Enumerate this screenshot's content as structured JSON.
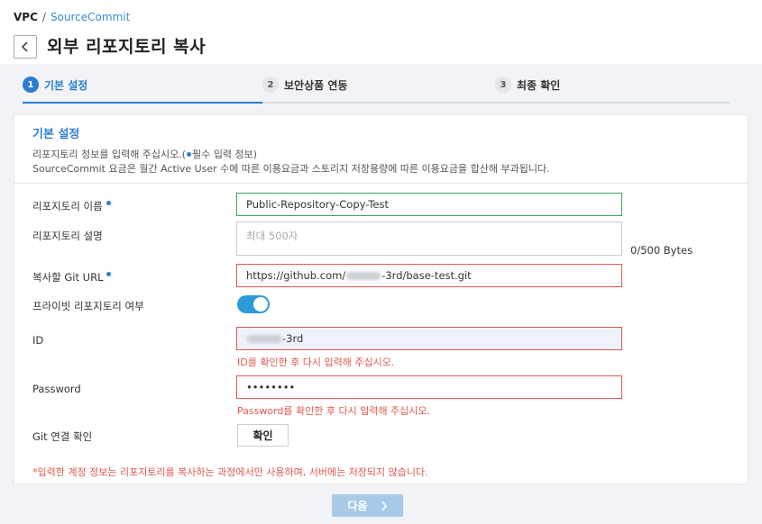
{
  "breadcrumb": {
    "root": "VPC",
    "separator": "/",
    "link": "SourceCommit"
  },
  "page_title": "외부 리포지토리 복사",
  "steps": [
    {
      "num": "1",
      "label": "기본 설정"
    },
    {
      "num": "2",
      "label": "보안상품 연동"
    },
    {
      "num": "3",
      "label": "최종 확인"
    }
  ],
  "card": {
    "title": "기본 설정",
    "desc_prefix": "리포지토리 정보를 입력해 주십시오.(",
    "desc_required": "필수 입력 정보)",
    "desc_line2": "SourceCommit 요금은 월간 Active User 수에 따른 이용요금과 스토리지 저장용량에 따른 이용요금을 합산해 부과됩니다."
  },
  "form": {
    "repo_name_label": "리포지토리 이름",
    "repo_name_value": "Public-Repository-Copy-Test",
    "repo_desc_label": "리포지토리 설명",
    "repo_desc_placeholder": "최대 500자",
    "repo_desc_bytes": "0/500 Bytes",
    "git_url_label": "복사할 Git URL",
    "git_url_prefix": "https://github.com/",
    "git_url_suffix": "-3rd/base-test.git",
    "private_label": "프라이빗 리포지토리 여부",
    "id_label": "ID",
    "id_suffix": "-3rd",
    "id_error": "ID를 확인한 후 다시 입력해 주십시오.",
    "password_label": "Password",
    "password_value": "••••••••",
    "password_error": "Password를 확인한 후 다시 입력해 주십시오.",
    "git_check_label": "Git 연결 확인",
    "git_check_button": "확인",
    "notice": "*입력한 계정 정보는 리포지토리를 복사하는 과정에서만 사용하며, 서버에는 저장되지 않습니다."
  },
  "next_button": "다음",
  "colors": {
    "accent": "#2c7dd1",
    "error": "#e0574f",
    "valid": "#3aa757"
  }
}
